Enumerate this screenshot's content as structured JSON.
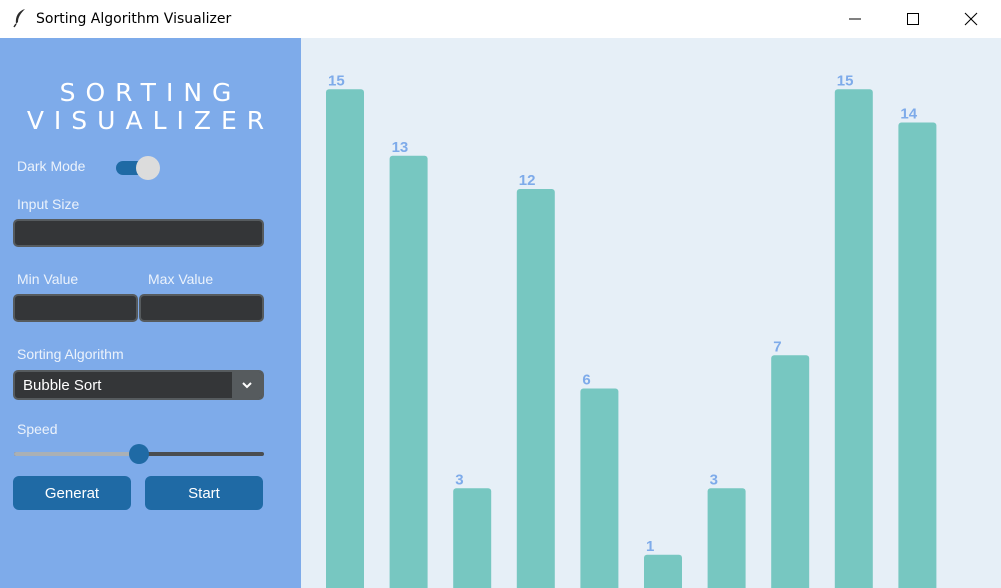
{
  "window": {
    "title": "Sorting Algorithm Visualizer",
    "icon": "feather-icon",
    "controls": [
      "minimize-icon",
      "maximize-icon",
      "close-icon"
    ]
  },
  "sidebar": {
    "brand_line1": "SORTING",
    "brand_line2": "VISUALIZER",
    "dark_mode_label": "Dark Mode",
    "dark_mode_on": true,
    "input_size_label": "Input Size",
    "input_size_value": "",
    "min_label": "Min Value",
    "min_value": "",
    "max_label": "Max Value",
    "max_value": "",
    "algorithm_label": "Sorting Algorithm",
    "algorithm_selected": "Bubble Sort",
    "speed_label": "Speed",
    "speed_fraction": 0.5,
    "generate_label": "Generat",
    "start_label": "Start"
  },
  "colors": {
    "sidebar_bg": "#7eabea",
    "canvas_bg": "#e6eff7",
    "bar": "#77c7c1",
    "value_label": "#7eabea",
    "accent": "#1f6aa5",
    "field_bg": "#343638"
  },
  "chart_data": {
    "type": "bar",
    "values": [
      15,
      13,
      3,
      12,
      6,
      1,
      3,
      7,
      15,
      14
    ],
    "ylim": [
      0,
      16.6
    ],
    "grid": false,
    "value_labels": true
  }
}
